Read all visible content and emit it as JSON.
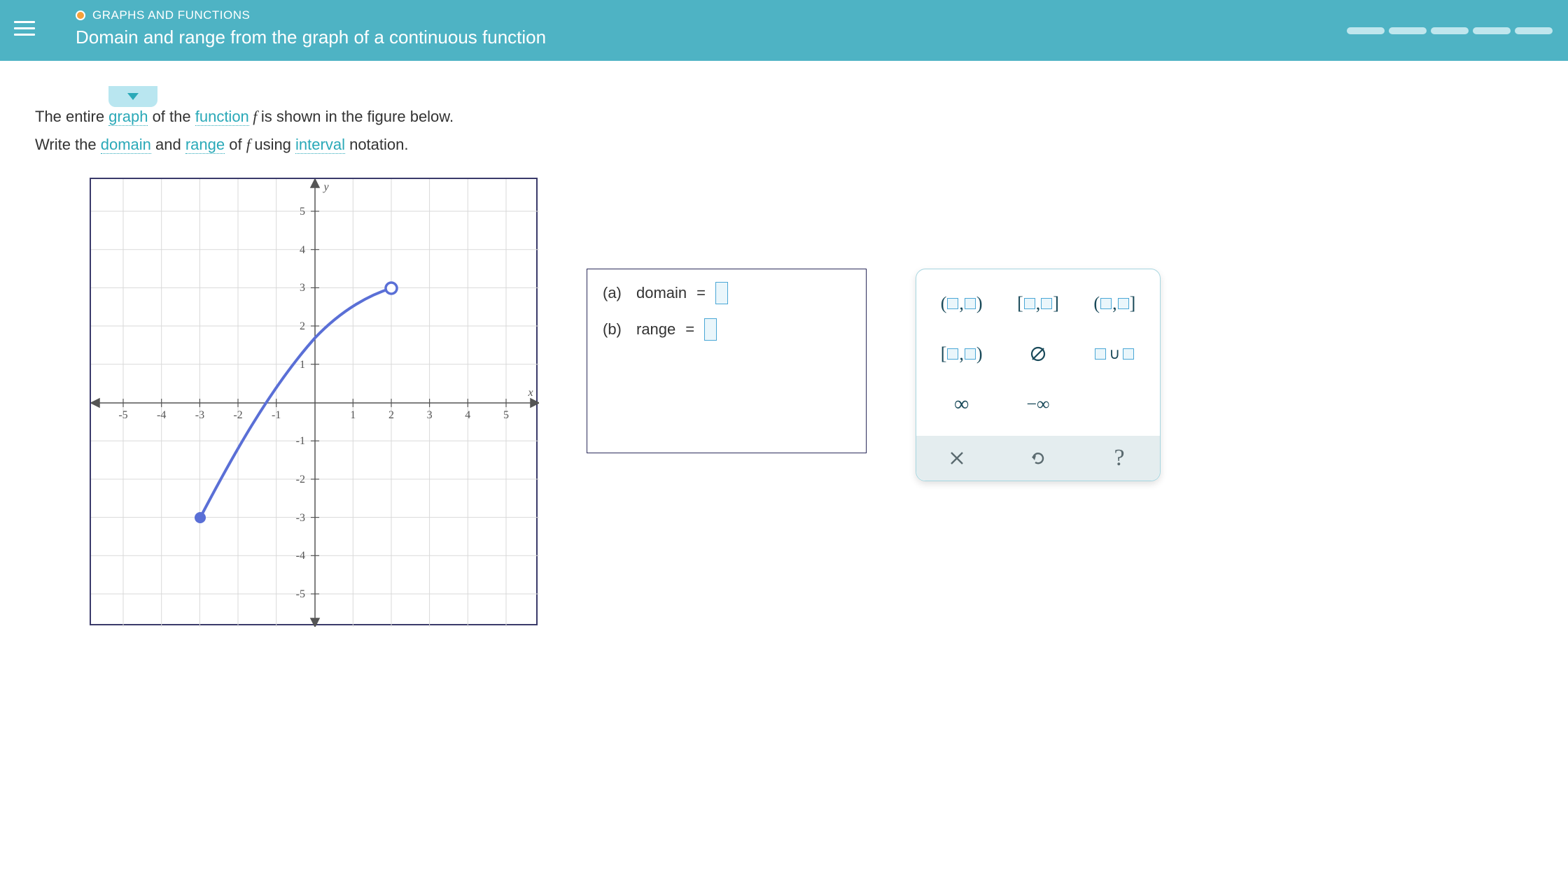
{
  "header": {
    "topic": "GRAPHS AND FUNCTIONS",
    "title": "Domain and range from the graph of a continuous function",
    "progress_segments": 5
  },
  "prompt": {
    "line1_pre": "The entire ",
    "kw_graph": "graph",
    "line1_mid": " of the ",
    "kw_function": "function",
    "line1_f": " f ",
    "line1_post": "is shown in the figure below.",
    "line2_pre": "Write the ",
    "kw_domain": "domain",
    "line2_and": " and ",
    "kw_range": "range",
    "line2_mid": " of ",
    "line2_f": "f ",
    "line2_using": "using ",
    "kw_interval": "interval",
    "line2_post": " notation."
  },
  "graph": {
    "x_axis_label": "x",
    "y_axis_label": "y",
    "x_ticks": [
      "-5",
      "-4",
      "-3",
      "-2",
      "-1",
      "1",
      "2",
      "3",
      "4",
      "5"
    ],
    "y_ticks": [
      "5",
      "4",
      "3",
      "2",
      "1",
      "-1",
      "-2",
      "-3",
      "-4",
      "-5"
    ]
  },
  "answers": {
    "a_label": "(a)",
    "a_name": "domain",
    "a_eq": "=",
    "b_label": "(b)",
    "b_name": "range",
    "b_eq": "="
  },
  "keypad": {
    "k1": "(□,□)",
    "k2": "[□,□]",
    "k3": "(□,□]",
    "k4": "[□,□)",
    "k5": "∅",
    "k6": "□∪□",
    "k7": "∞",
    "k8": "−∞"
  },
  "actions": {
    "clear": "×",
    "undo": "↺",
    "help": "?"
  },
  "chart_data": {
    "type": "line",
    "title": "",
    "xlabel": "x",
    "ylabel": "y",
    "xlim": [
      -5.8,
      5.8
    ],
    "ylim": [
      -5.8,
      5.8
    ],
    "x_ticks": [
      -5,
      -4,
      -3,
      -2,
      -1,
      1,
      2,
      3,
      4,
      5
    ],
    "y_ticks": [
      -5,
      -4,
      -3,
      -2,
      -1,
      1,
      2,
      3,
      4,
      5
    ],
    "series": [
      {
        "name": "f",
        "color": "#5a6fd6",
        "points": [
          {
            "x": -3,
            "y": -3,
            "endpoint": "closed"
          },
          {
            "x": -2,
            "y": -1.6
          },
          {
            "x": -1,
            "y": 0.4
          },
          {
            "x": 0,
            "y": 1.7
          },
          {
            "x": 1,
            "y": 2.7
          },
          {
            "x": 2,
            "y": 3,
            "endpoint": "open"
          }
        ]
      }
    ]
  }
}
